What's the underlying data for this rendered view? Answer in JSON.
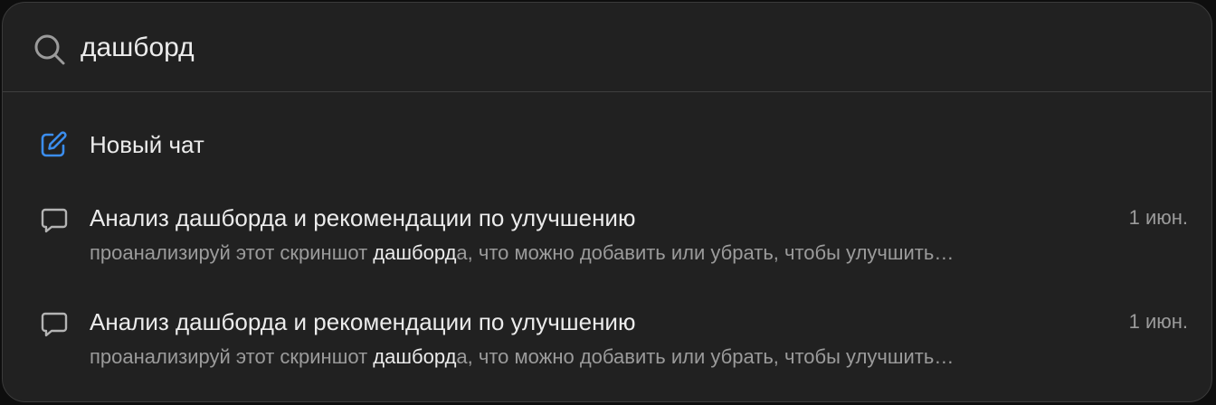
{
  "search": {
    "query": "дашборд"
  },
  "new_chat": {
    "label": "Новый чат"
  },
  "results": [
    {
      "title": "Анализ дашборда и рекомендации по улучшению",
      "snippet_before": "проанализируй этот скриншот ",
      "snippet_match": "дашборд",
      "snippet_after": "а, что можно добавить или убрать, чтобы улучшить…",
      "date": "1 июн."
    },
    {
      "title": "Анализ дашборда и рекомендации по улучшению",
      "snippet_before": "проанализируй этот скриншот ",
      "snippet_match": "дашборд",
      "snippet_after": "а, что можно добавить или убрать, чтобы улучшить…",
      "date": "1 июн."
    }
  ],
  "colors": {
    "background": "#212121",
    "text_primary": "#ececec",
    "text_secondary": "#9b9b9b",
    "accent": "#3b8ded",
    "divider": "#3f3f3f"
  }
}
